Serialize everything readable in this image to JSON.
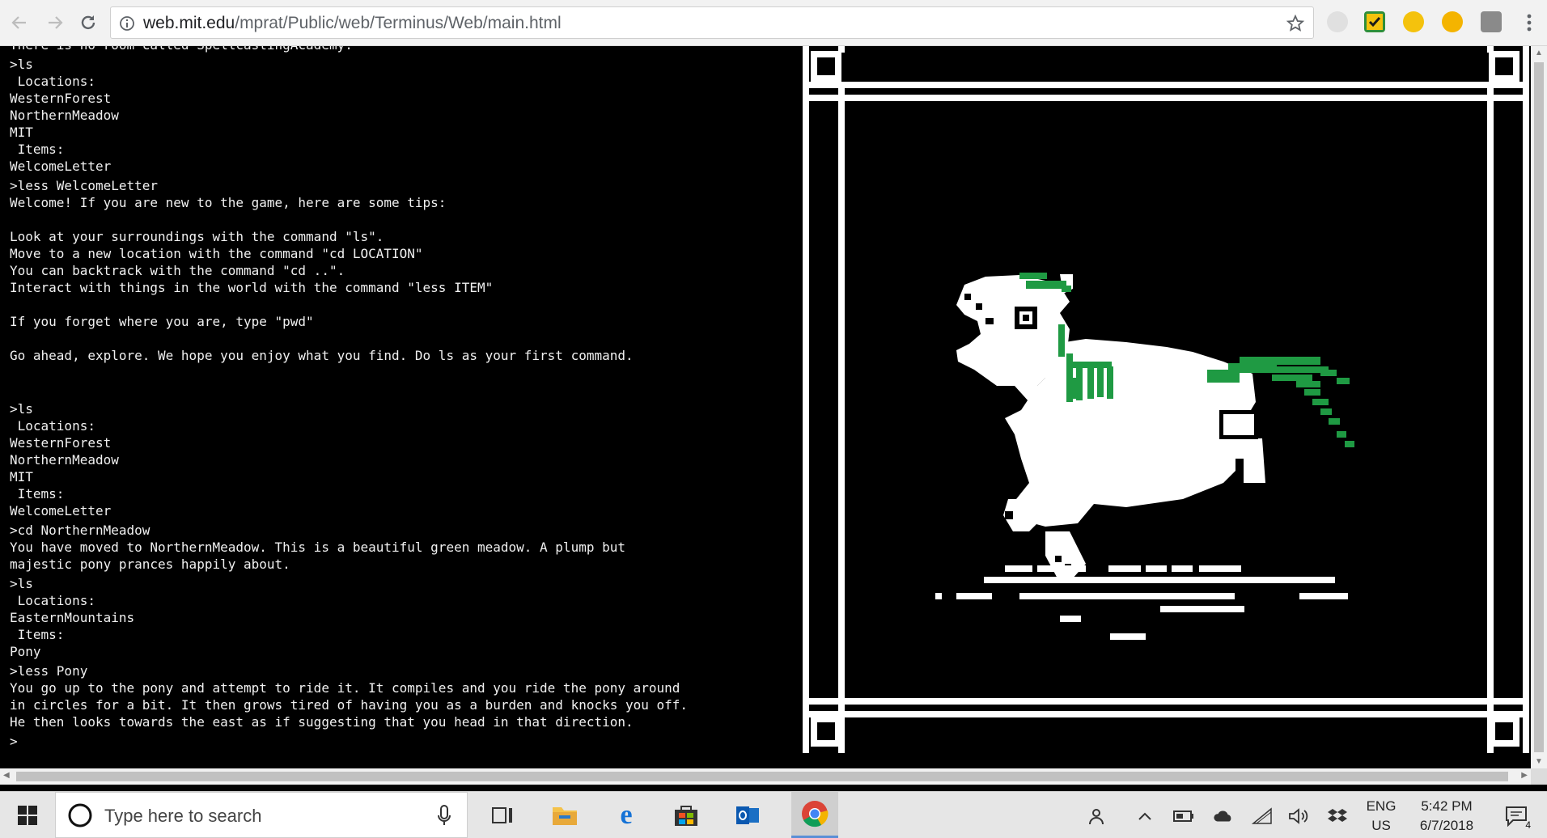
{
  "browser": {
    "url_domain": "web.mit.edu",
    "url_path": "/mprat/Public/web/Terminus/Web/main.html"
  },
  "terminal": {
    "partial_top_line": "There is no room called SpellcastingAcademy.",
    "lines": [
      ">ls",
      " Locations:",
      "WesternForest",
      "NorthernMeadow",
      "MIT",
      " Items:",
      "WelcomeLetter",
      ">less WelcomeLetter",
      "Welcome! If you are new to the game, here are some tips:",
      "",
      "Look at your surroundings with the command \"ls\".",
      "Move to a new location with the command \"cd LOCATION\"",
      "You can backtrack with the command \"cd ..\".",
      "Interact with things in the world with the command \"less ITEM\"",
      "",
      "If you forget where you are, type \"pwd\"",
      "",
      "Go ahead, explore. We hope you enjoy what you find. Do ls as your first command.",
      "",
      "",
      ">ls",
      " Locations:",
      "WesternForest",
      "NorthernMeadow",
      "MIT",
      " Items:",
      "WelcomeLetter",
      ">cd NorthernMeadow",
      "You have moved to NorthernMeadow. This is a beautiful green meadow. A plump but",
      "majestic pony prances happily about.",
      ">ls",
      " Locations:",
      "EasternMountains",
      " Items:",
      "Pony",
      ">less Pony",
      "You go up to the pony and attempt to ride it. It compiles and you ride the pony around",
      "in circles for a bit. It then grows tired of having you as a burden and knocks you off.",
      "He then looks towards the east as if suggesting that you head in that direction.",
      ">"
    ]
  },
  "taskbar": {
    "search_placeholder": "Type here to search",
    "lang_line1": "ENG",
    "lang_line2": "US",
    "time": "5:42 PM",
    "date": "6/7/2018",
    "notification_count": "4"
  },
  "colors": {
    "pony_mane": "#1f9a43",
    "terminal_bg": "#000000",
    "terminal_text": "#f0f0f0"
  }
}
